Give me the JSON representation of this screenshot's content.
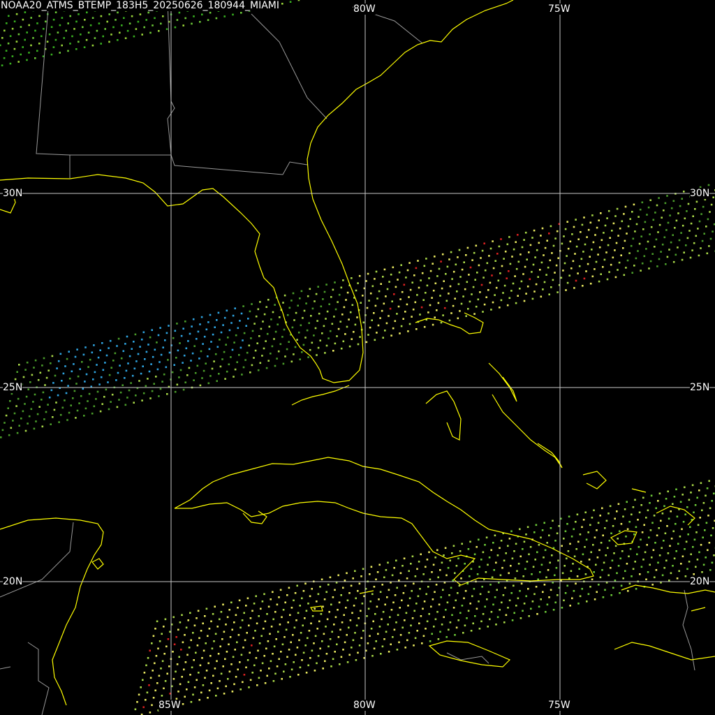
{
  "title": "NOAA20_ATMS_BTEMP_183H5_20250626_180944_MIAMI",
  "grid": {
    "lon_labels": [
      "85W",
      "80W",
      "75W"
    ],
    "lat_labels": [
      "30N",
      "25N",
      "20N"
    ],
    "line_color": "#c8c8c8"
  },
  "colors": {
    "coastline": "#ffff00",
    "borders": "#9a9a9a",
    "background": "#000000"
  },
  "swaths": [
    {
      "name": "swath-northwest",
      "palette": [
        "#38b020",
        "#6cc838",
        "#2fa4e0",
        "#9ad63a"
      ],
      "dominant": "green-blue"
    },
    {
      "name": "swath-central",
      "palette": [
        "#4a9c2a",
        "#2fa4e0",
        "#a8d848",
        "#e8e860",
        "#d82020"
      ],
      "dominant": "green-yellow-blue"
    },
    {
      "name": "swath-south",
      "palette": [
        "#6cc838",
        "#a8d848",
        "#e8e860",
        "#d82020"
      ],
      "dominant": "green-yellow"
    }
  ]
}
